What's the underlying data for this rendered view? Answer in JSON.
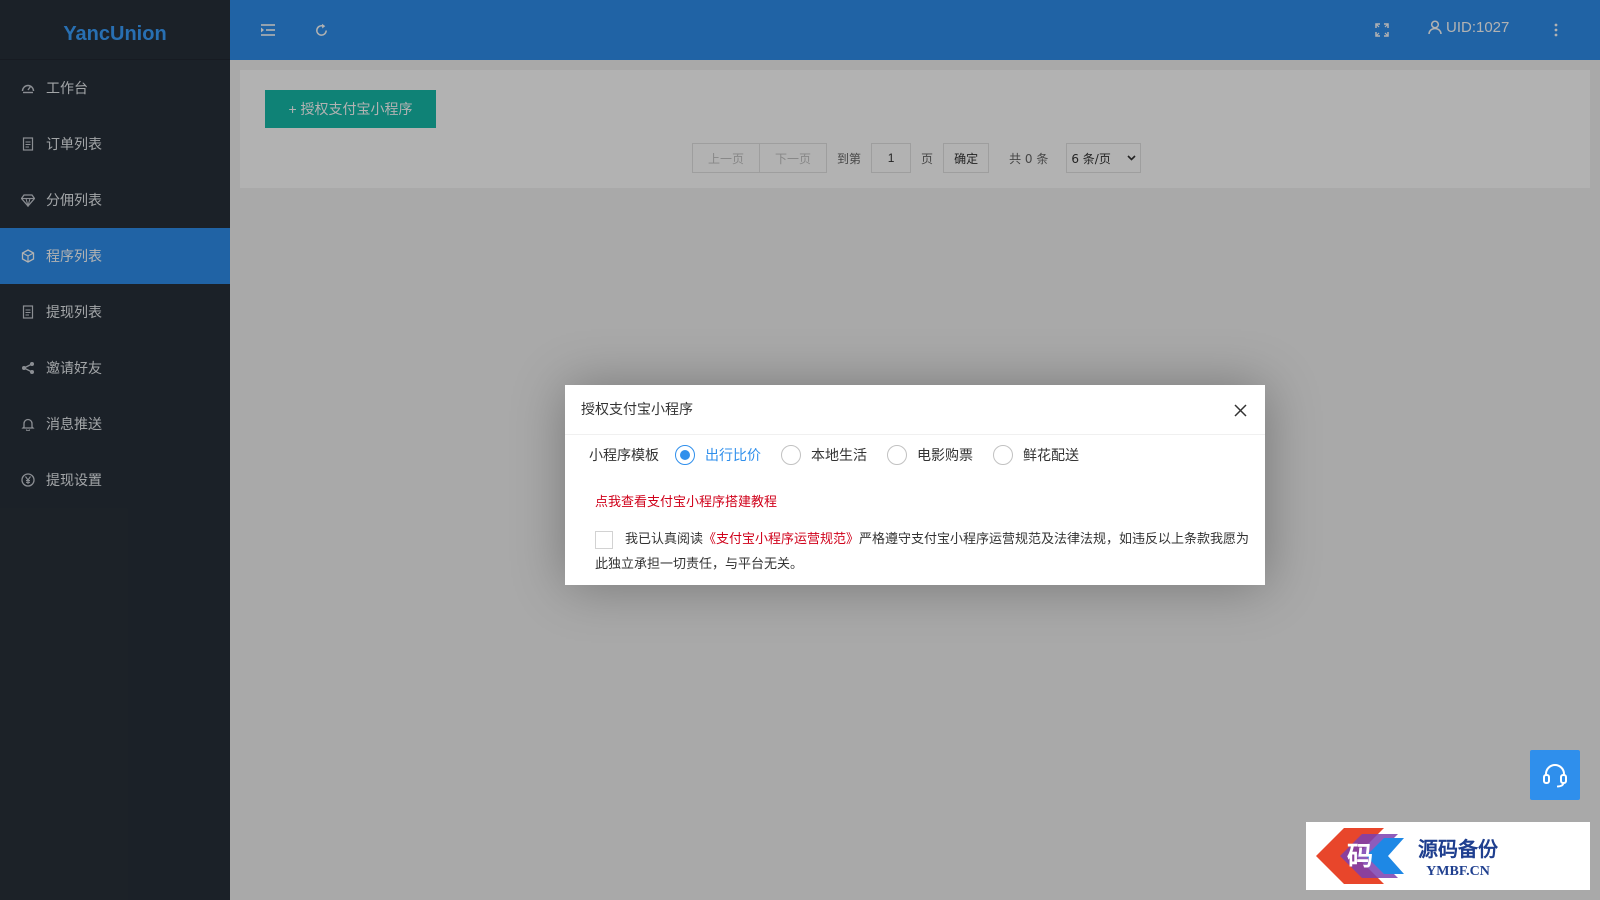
{
  "app": {
    "brand": "YancUnion"
  },
  "sidebar": {
    "items": [
      {
        "label": "工作台",
        "icon": "dashboard-icon"
      },
      {
        "label": "订单列表",
        "icon": "document-icon"
      },
      {
        "label": "分佣列表",
        "icon": "diamond-icon"
      },
      {
        "label": "程序列表",
        "icon": "cube-icon",
        "active": true
      },
      {
        "label": "提现列表",
        "icon": "document-icon"
      },
      {
        "label": "邀请好友",
        "icon": "share-icon"
      },
      {
        "label": "消息推送",
        "icon": "bell-icon"
      },
      {
        "label": "提现设置",
        "icon": "yen-circle-icon"
      }
    ]
  },
  "header": {
    "uid": "UID:1027",
    "icons": [
      "menu-fold-icon",
      "refresh-icon",
      "fullscreen-icon",
      "user-icon",
      "more-vertical-icon"
    ]
  },
  "main": {
    "auth_button": "+ 授权支付宝小程序",
    "pager": {
      "prev": "上一页",
      "next": "下一页",
      "goto_prefix": "到第",
      "page_value": "1",
      "goto_suffix": "页",
      "confirm": "确定",
      "total": "共 0 条",
      "page_size": "6 条/页"
    }
  },
  "dialog": {
    "title": "授权支付宝小程序",
    "template_label": "小程序模板",
    "templates": [
      {
        "label": "出行比价",
        "checked": true
      },
      {
        "label": "本地生活",
        "checked": false
      },
      {
        "label": "电影购票",
        "checked": false
      },
      {
        "label": "鲜花配送",
        "checked": false
      }
    ],
    "tutorial_link": "点我查看支付宝小程序搭建教程",
    "agree_prefix": "我已认真阅读",
    "agree_link": "《支付宝小程序运营规范》",
    "agree_suffix": "严格遵守支付宝小程序运营规范及法律法规，如违反以上条款我愿为此独立承担一切责任，与平台无关。"
  },
  "watermark": {
    "cn": "源码备份",
    "en": "YMBF.CN",
    "mark": "码"
  },
  "colors": {
    "primary": "#2f8fec",
    "sidebar": "#28303a",
    "teal": "#16baaa",
    "link_red": "#d0021b"
  }
}
